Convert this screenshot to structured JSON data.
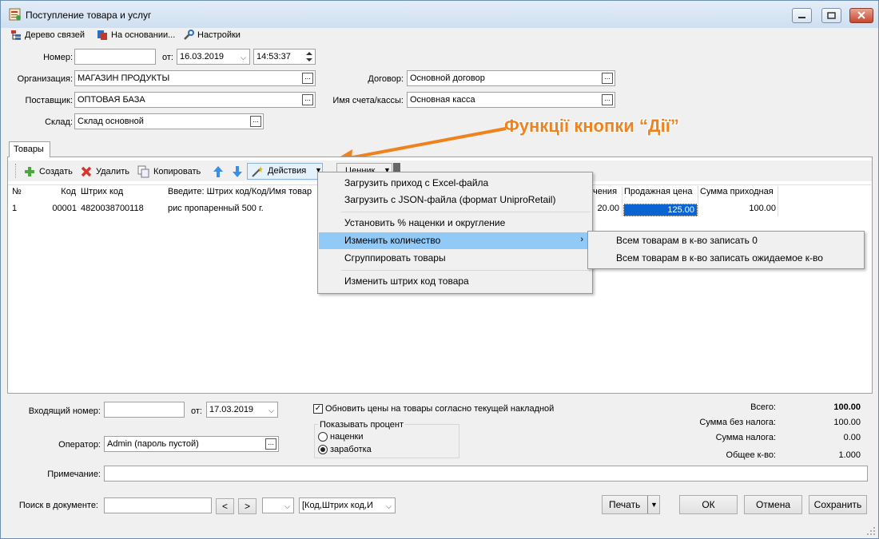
{
  "window": {
    "title": "Поступление товара и услуг"
  },
  "toolbar": {
    "tree_label": "Дерево связей",
    "based_on_label": "На основании...",
    "settings_label": "Настройки"
  },
  "header": {
    "number_label": "Номер:",
    "number_value": "",
    "from_label": "от:",
    "date_value": "16.03.2019",
    "time_value": "14:53:37",
    "org_label": "Организация:",
    "org_value": "МАГАЗИН ПРОДУКТЫ",
    "contract_label": "Договор:",
    "contract_value": "Основной договор",
    "supplier_label": "Поставщик:",
    "supplier_value": "ОПТОВАЯ БАЗА",
    "account_label": "Имя счета/кассы:",
    "account_value": "Основная касса",
    "warehouse_label": "Склад:",
    "warehouse_value": "Склад основной"
  },
  "annotation": {
    "text": "Функції кнопки “Дії”",
    "color": "#f0821e"
  },
  "tabs": {
    "goods": "Товары"
  },
  "grid_toolbar": {
    "create": "Создать",
    "delete": "Удалить",
    "copy": "Копировать",
    "actions": "Действия",
    "price_tag": "Ценник"
  },
  "grid": {
    "headers": [
      "№",
      "Код",
      "Штрих код",
      "Введите: Штрих код/Код/Имя товар",
      "чения",
      "Продажная цена",
      "Сумма приходная"
    ],
    "rows": [
      {
        "num": "1",
        "code": "00001",
        "barcode": "4820038700118",
        "name": "рис пропаренный 500 г.",
        "val": "20.00",
        "sale_price": "125.00",
        "sum": "100.00"
      }
    ]
  },
  "actions_menu": {
    "items": [
      "Загрузить приход с Excel-файла",
      "Загрузить с JSON-файла (формат UniproRetail)",
      "Установить % наценки и округление",
      "Изменить количество",
      "Сгруппировать товары",
      "Изменить штрих код товара"
    ],
    "highlighted_index": 3,
    "submenu": [
      "Всем товарам в к-во записать 0",
      "Всем товарам в к-во записать ожидаемое к-во"
    ]
  },
  "footer": {
    "incoming_label": "Входящий номер:",
    "incoming_value": "",
    "from_label": "от:",
    "incoming_date": "17.03.2019",
    "update_prices_label": "Обновить цены на товары согласно текущей накладной",
    "update_prices_checked": true,
    "operator_label": "Оператор:",
    "operator_value": "Admin (пароль пустой)",
    "show_percent_label": "Показывать процент",
    "radio_markup": "наценки",
    "radio_profit": "заработка",
    "note_label": "Примечание:",
    "note_value": "",
    "search_label": "Поиск в документе:",
    "search_value": "",
    "prev": "<",
    "next": ">",
    "search_field_value": "[Код,Штрих код,И",
    "total_label": "Всего:",
    "total_value": "100.00",
    "no_tax_label": "Сумма без налога:",
    "no_tax_value": "100.00",
    "tax_label": "Сумма налога:",
    "tax_value": "0.00",
    "qty_label": "Общее к-во:",
    "qty_value": "1.000",
    "print": "Печать",
    "ok": "ОК",
    "cancel": "Отмена",
    "save": "Сохранить"
  }
}
